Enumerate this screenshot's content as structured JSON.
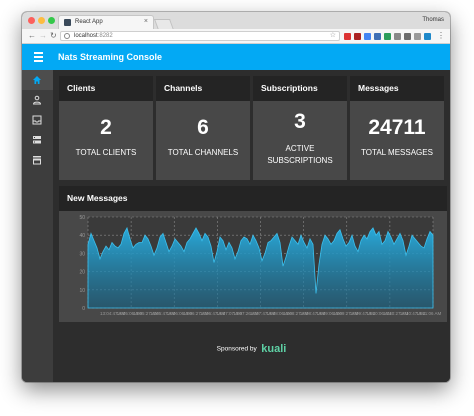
{
  "browser": {
    "tab_title": "React App",
    "tab_close": "×",
    "profile_name": "Thomas",
    "url_host": "localhost",
    "url_port": ":8282",
    "star": "☆",
    "menu": "⋮"
  },
  "app": {
    "title": "Nats Streaming Console",
    "accent_color": "#03a9f4"
  },
  "sidebar": {
    "items": [
      {
        "icon": "home-icon",
        "active": true
      },
      {
        "icon": "person-icon",
        "active": false
      },
      {
        "icon": "inbox-icon",
        "active": false
      },
      {
        "icon": "storage-icon",
        "active": false
      },
      {
        "icon": "store-icon",
        "active": false
      }
    ]
  },
  "cards": [
    {
      "title": "Clients",
      "value": "2",
      "label": "TOTAL CLIENTS"
    },
    {
      "title": "Channels",
      "value": "6",
      "label": "TOTAL CHANNELS"
    },
    {
      "title": "Subscriptions",
      "value": "3",
      "label_line1": "ACTIVE",
      "label_line2": "SUBSCRIPTIONS"
    },
    {
      "title": "Messages",
      "value": "24711",
      "label": "TOTAL MESSAGES"
    }
  ],
  "new_messages": {
    "title": "New Messages"
  },
  "chart_data": {
    "type": "area",
    "title": "New Messages",
    "ylim": [
      0,
      50
    ],
    "yticks": [
      "50",
      "40",
      "30",
      "20",
      "10",
      "0"
    ],
    "xticks": [
      "13:04:47 AM",
      "13:05:06 AM",
      "13:05:27 AM",
      "13:05:47 AM",
      "13:06:06 AM",
      "13:06:27 AM",
      "13:06:47 AM",
      "13:07:07 AM",
      "13:07:26 AM",
      "13:07:47 AM",
      "13:08:06 AM",
      "13:08:27 AM",
      "13:08:47 AM",
      "13:09:06 AM",
      "13:09:27 AM",
      "13:09:47 AM",
      "13:10:06 AM",
      "13:10:27 AM",
      "13:10:47 AM",
      "13:11:06 AM"
    ],
    "values": [
      35,
      41,
      37,
      33,
      27,
      31,
      34,
      32,
      36,
      34,
      33,
      35,
      41,
      44,
      38,
      33,
      35,
      36,
      36,
      40,
      38,
      34,
      29,
      33,
      39,
      41,
      36,
      31,
      34,
      38,
      36,
      34,
      31,
      36,
      38,
      41,
      44,
      41,
      37,
      41,
      39,
      34,
      25,
      31,
      39,
      37,
      32,
      36,
      33,
      27,
      31,
      37,
      39,
      38,
      35,
      40,
      37,
      33,
      26,
      30,
      36,
      37,
      39,
      41,
      36,
      23,
      28,
      34,
      39,
      37,
      35,
      40,
      36,
      33,
      38,
      35,
      8,
      24,
      35,
      40,
      38,
      35,
      37,
      41,
      43,
      38,
      34,
      36,
      40,
      34,
      31,
      37,
      40,
      38,
      42,
      44,
      40,
      42,
      35,
      37,
      42,
      39,
      35,
      38,
      41,
      37,
      29,
      34,
      40,
      38,
      36,
      34,
      33,
      38,
      42,
      40
    ],
    "fill_color": "#29a9d9",
    "grid": true
  },
  "sponsor": {
    "text": "Sponsored by",
    "brand": "kuali"
  }
}
